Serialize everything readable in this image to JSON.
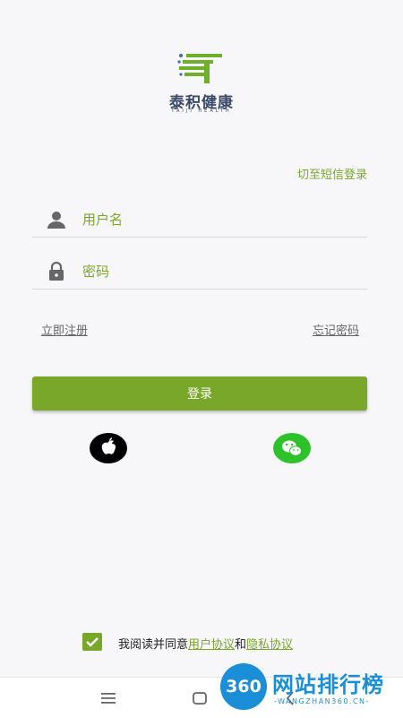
{
  "brand": {
    "name": "泰积健康",
    "subtitle": "TAIJI HEALTH",
    "logo_icon": "taiji-logo-icon",
    "accent_color": "#79a72a"
  },
  "header": {
    "sms_login_label": "切至短信登录"
  },
  "form": {
    "username": {
      "placeholder": "用户名",
      "value": "",
      "icon": "user-icon"
    },
    "password": {
      "placeholder": "密码",
      "value": "",
      "icon": "lock-icon"
    },
    "register_label": "立即注册",
    "forgot_label": "忘记密码",
    "login_label": "登录"
  },
  "social": {
    "apple_icon": "apple-icon",
    "wechat_icon": "wechat-icon"
  },
  "agreement": {
    "checked": true,
    "prefix": "我阅读并同意",
    "user_agreement": "用户协议",
    "conjunction": "和",
    "privacy_agreement": "隐私协议"
  },
  "navbar": {
    "icons": [
      "menu-icon",
      "home-square-icon",
      "back-chevron-icon"
    ]
  },
  "watermark": {
    "badge": "360",
    "text": "网站排行榜",
    "url": "-WANGZHAN360.CN-"
  }
}
